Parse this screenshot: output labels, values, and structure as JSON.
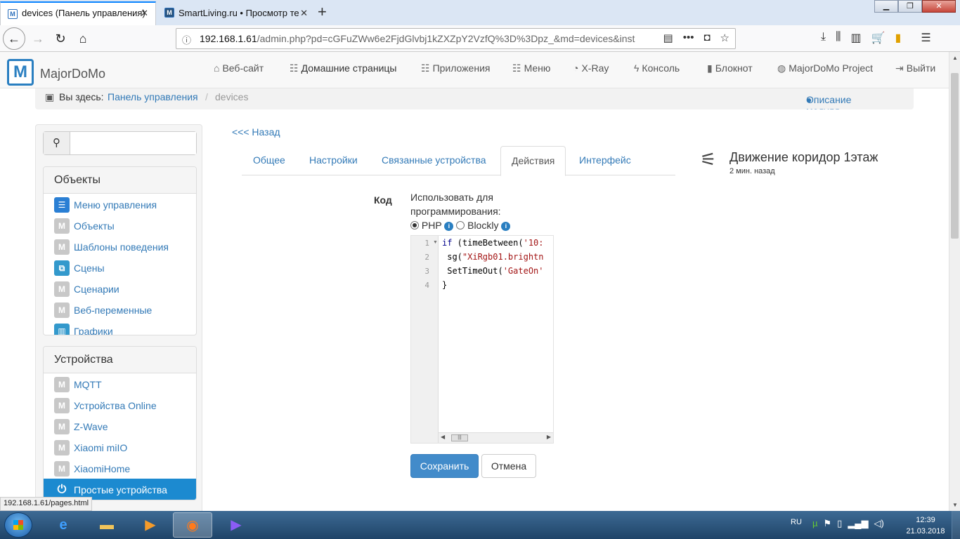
{
  "browser": {
    "tabs": [
      {
        "title": "devices (Панель управления)",
        "active": true
      },
      {
        "title": "SmartLiving.ru • Просмотр те",
        "active": false
      }
    ],
    "url_host": "192.168.1.61",
    "url_path": "/admin.php?pd=cGFuZWw6e2FjdGlvbj1kZXZpY2VzfQ%3D%3Dpz_&md=devices&inst",
    "status_url": "192.168.1.61/pages.html"
  },
  "app": {
    "logo": "MajorDoMo",
    "menu": [
      "Веб-сайт",
      "Домашние страницы",
      "Приложения",
      "Меню",
      "X-Ray",
      "Консоль",
      "Блокнот",
      "MajorDoMo Project",
      "Выйти"
    ],
    "breadcrumb": {
      "prefix": "Вы здесь:",
      "home": "Панель управления",
      "sep": "/",
      "current": "devices",
      "module_help": "Описание модуля"
    }
  },
  "sidebar": {
    "search_placeholder": "",
    "sections": [
      {
        "title": "Объекты",
        "items": [
          "Меню управления",
          "Объекты",
          "Шаблоны поведения",
          "Сцены",
          "Сценарии",
          "Веб-переменные",
          "Графики"
        ]
      },
      {
        "title": "Устройства",
        "items": [
          "MQTT",
          "Устройства Online",
          "Z-Wave",
          "Xiaomi miIO",
          "XiaomiHome",
          "Простые устройства"
        ]
      }
    ]
  },
  "main": {
    "back_link": "<<< Назад",
    "tabs": [
      "Общее",
      "Настройки",
      "Связанные устройства",
      "Действия",
      "Интерфейс"
    ],
    "active_tab": "Действия",
    "device": {
      "title": "Движение коридор 1этаж",
      "updated": "2 мин. назад"
    },
    "code_label": "Код",
    "use_for_label": "Использовать для программирования:",
    "options": [
      "PHP",
      "Blockly"
    ],
    "selected_option": "PHP",
    "code_lines": [
      "1",
      "2",
      "3",
      "4"
    ],
    "code": {
      "l1_kw": "if",
      "l1_rest": " (timeBetween(",
      "l1_str": "'10:",
      "l2_a": " sg(",
      "l2_str": "\"XiRgb01.brightn",
      "l3_a": " SetTimeOut(",
      "l3_str": "'GateOn'",
      "l4": "}"
    },
    "save_button": "Сохранить",
    "cancel_button": "Отмена"
  },
  "taskbar": {
    "lang": "RU",
    "time": "12:39",
    "date": "21.03.2018"
  },
  "colors": {
    "primary": "#428bca",
    "link": "#337ab7",
    "active_item": "#1c8ad0",
    "taskbar": "#2a5580"
  }
}
